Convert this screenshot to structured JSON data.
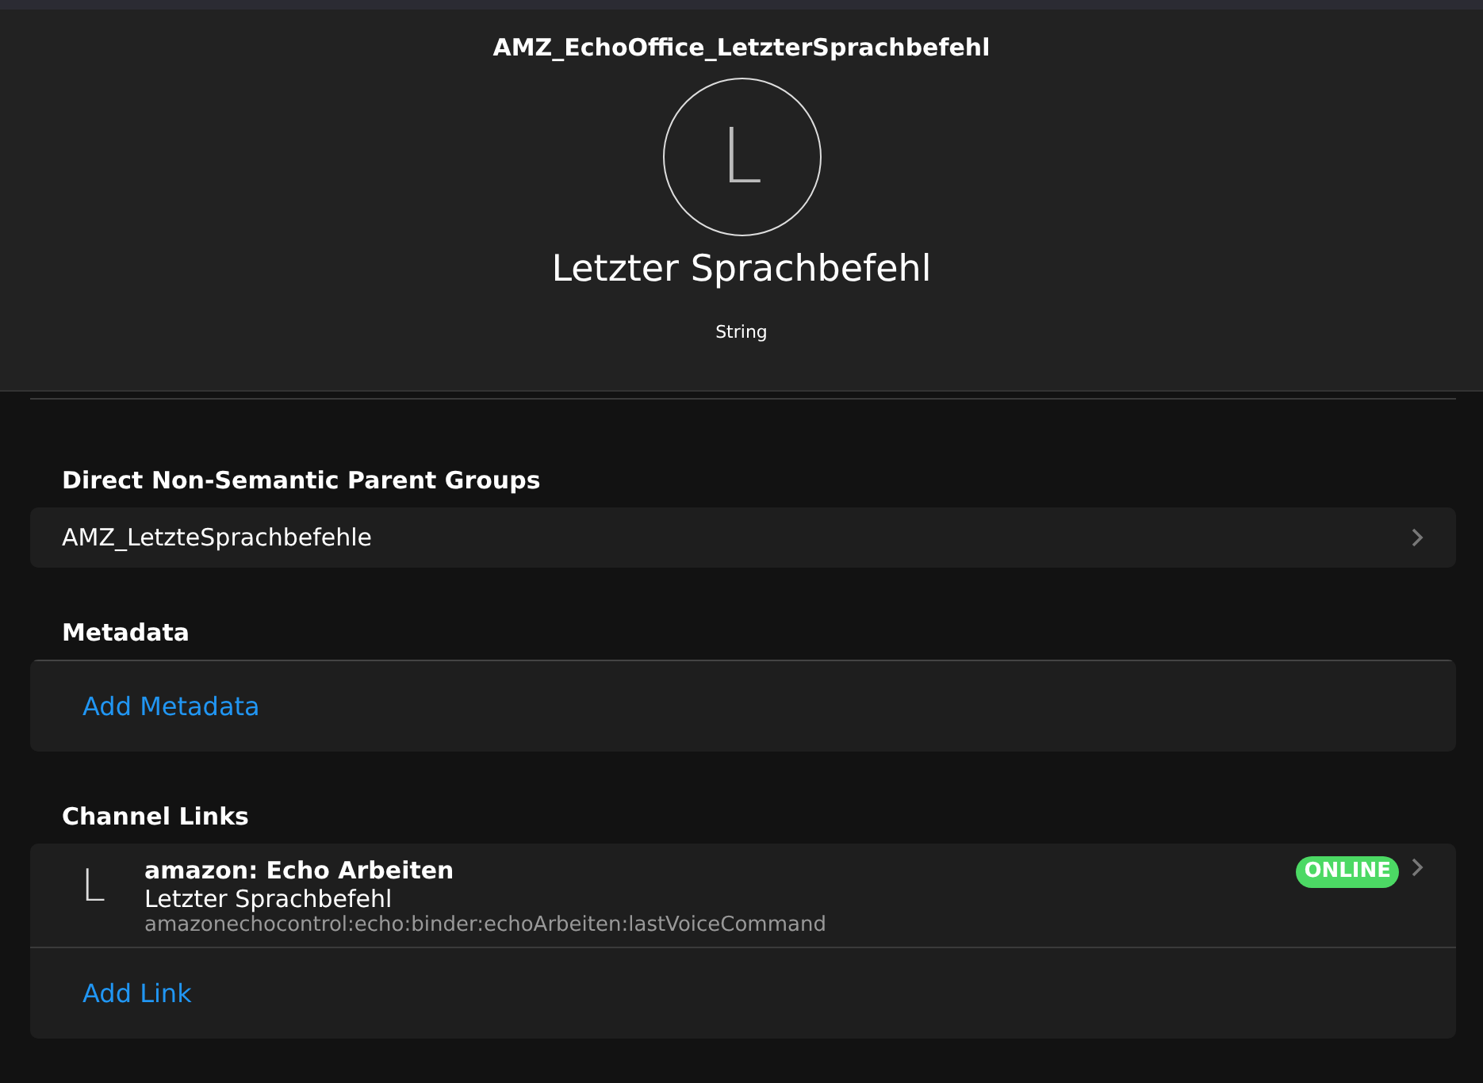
{
  "header": {
    "title": "AMZ_EchoOffice_LetzterSprachbefehl",
    "avatar_letter": "L",
    "label": "Letzter Sprachbefehl",
    "type": "String"
  },
  "parent_groups": {
    "heading": "Direct Non-Semantic Parent Groups",
    "items": [
      "AMZ_LetzteSprachbefehle"
    ]
  },
  "metadata": {
    "heading": "Metadata",
    "add": "Add Metadata"
  },
  "channel_links": {
    "heading": "Channel Links",
    "items": [
      {
        "icon_letter": "L",
        "thing": "amazon: Echo Arbeiten",
        "channel": "Letzter Sprachbefehl",
        "uid": "amazonechocontrol:echo:binder:echoArbeiten:lastVoiceCommand",
        "status": "ONLINE",
        "color": "#4cd964"
      }
    ],
    "add": "Add Link"
  }
}
